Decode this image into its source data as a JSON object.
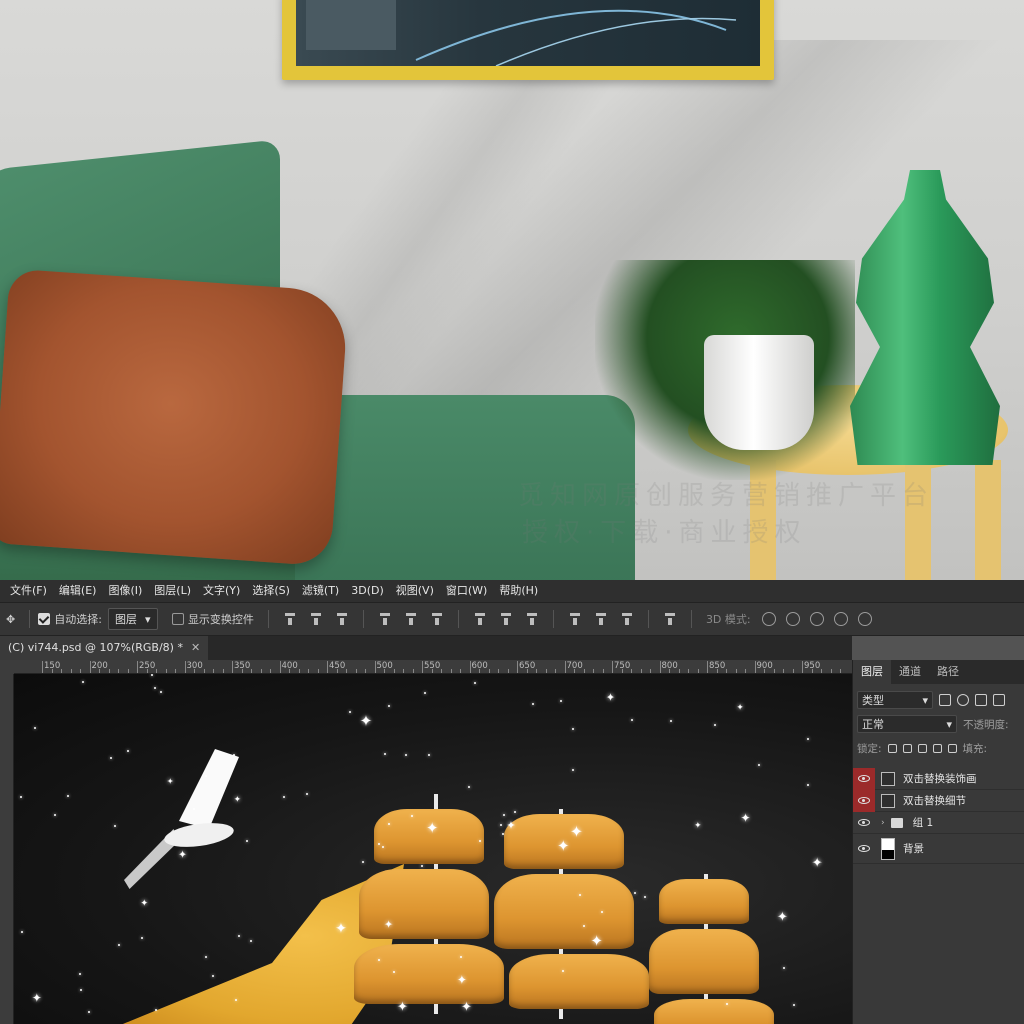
{
  "menubar": {
    "items": [
      "文件(F)",
      "编辑(E)",
      "图像(I)",
      "图层(L)",
      "文字(Y)",
      "选择(S)",
      "滤镜(T)",
      "3D(D)",
      "视图(V)",
      "窗口(W)",
      "帮助(H)"
    ]
  },
  "options": {
    "auto_select_label": "自动选择:",
    "auto_select_value": "图层",
    "show_transform_label": "显示变换控件",
    "mode3d_label": "3D 模式:"
  },
  "document": {
    "tab_title": "(C) vi744.psd @ 107%(RGB/8) *"
  },
  "ruler": {
    "h_labels": [
      "150",
      "200",
      "250",
      "300",
      "350",
      "400",
      "450",
      "500",
      "550",
      "600",
      "650",
      "700",
      "750",
      "800",
      "850",
      "900",
      "950"
    ]
  },
  "layers_panel": {
    "tabs": [
      "图层",
      "通道",
      "路径"
    ],
    "filter_label": "类型",
    "blend_mode": "正常",
    "opacity_label": "不透明度:",
    "lock_label": "锁定:",
    "fill_label": "填充:",
    "layers": [
      {
        "name": "双击替换装饰画",
        "type": "smart"
      },
      {
        "name": "双击替换细节",
        "type": "smart"
      },
      {
        "name": "组 1",
        "type": "group"
      },
      {
        "name": "背景",
        "type": "background"
      }
    ]
  },
  "scene": {
    "watermark_line1": "觅知网原创服务营销推广平台",
    "watermark_line2": "授权·下载·商业授权"
  },
  "colors": {
    "accent_visibility": "#9b2a2a",
    "panel_bg": "#393939",
    "menubar_bg": "#2f2f2f"
  }
}
